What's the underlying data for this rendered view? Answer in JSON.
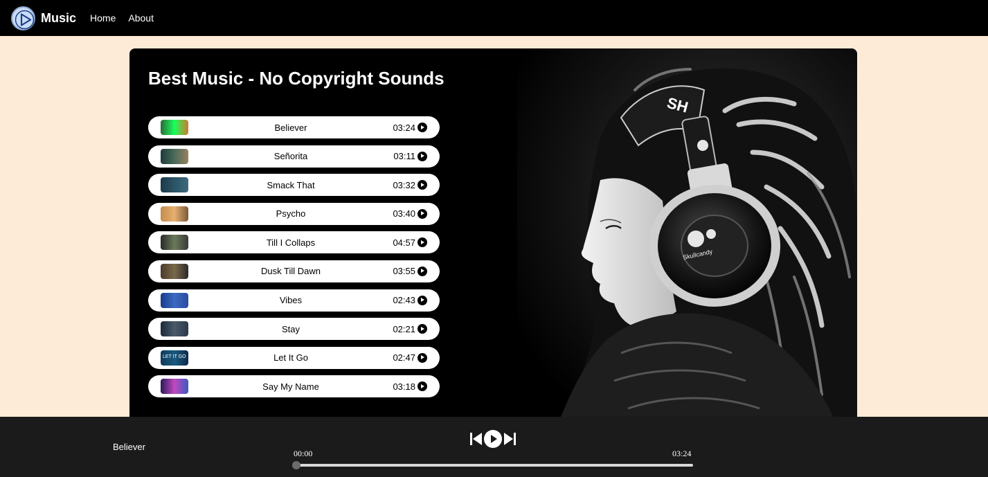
{
  "nav": {
    "brand": "Music",
    "links": [
      "Home",
      "About"
    ]
  },
  "page": {
    "title": "Best Music - No Copyright Sounds"
  },
  "songs": [
    {
      "title": "Believer",
      "duration": "03:24",
      "thumb_colors": [
        "#2a6b3a",
        "#1aff5a",
        "#d17a2b"
      ]
    },
    {
      "title": "Señorita",
      "duration": "03:11",
      "thumb_colors": [
        "#1e3b3c",
        "#4a6b5a",
        "#9a8060"
      ]
    },
    {
      "title": "Smack That",
      "duration": "03:32",
      "thumb_colors": [
        "#1b3a4a",
        "#2b5566",
        "#3c6a7c"
      ]
    },
    {
      "title": "Psycho",
      "duration": "03:40",
      "thumb_colors": [
        "#c58b4a",
        "#e6b070",
        "#7a5a3a"
      ]
    },
    {
      "title": "Till I Collaps",
      "duration": "04:57",
      "thumb_colors": [
        "#2a2a2a",
        "#6a7a5a",
        "#3a3a3a"
      ]
    },
    {
      "title": "Dusk Till Dawn",
      "duration": "03:55",
      "thumb_colors": [
        "#4a3a2a",
        "#7a6a4a",
        "#2a2a2a"
      ]
    },
    {
      "title": "Vibes",
      "duration": "02:43",
      "thumb_colors": [
        "#1a3a8a",
        "#3a6ac0",
        "#2a4aa0"
      ]
    },
    {
      "title": "Stay",
      "duration": "02:21",
      "thumb_colors": [
        "#1a2a3a",
        "#4a5a6a",
        "#2a3a4a"
      ]
    },
    {
      "title": "Let It Go",
      "duration": "02:47",
      "thumb_colors": [
        "#0d3a5a",
        "#1a5a80",
        "#0d2a4a"
      ],
      "thumb_text": "LET IT GO"
    },
    {
      "title": "Say My Name",
      "duration": "03:18",
      "thumb_colors": [
        "#2a1a5a",
        "#c04ac0",
        "#3a5ac0"
      ]
    }
  ],
  "player": {
    "now_playing": "Believer",
    "current_time": "00:00",
    "total_time": "03:24",
    "progress": 0.0
  }
}
